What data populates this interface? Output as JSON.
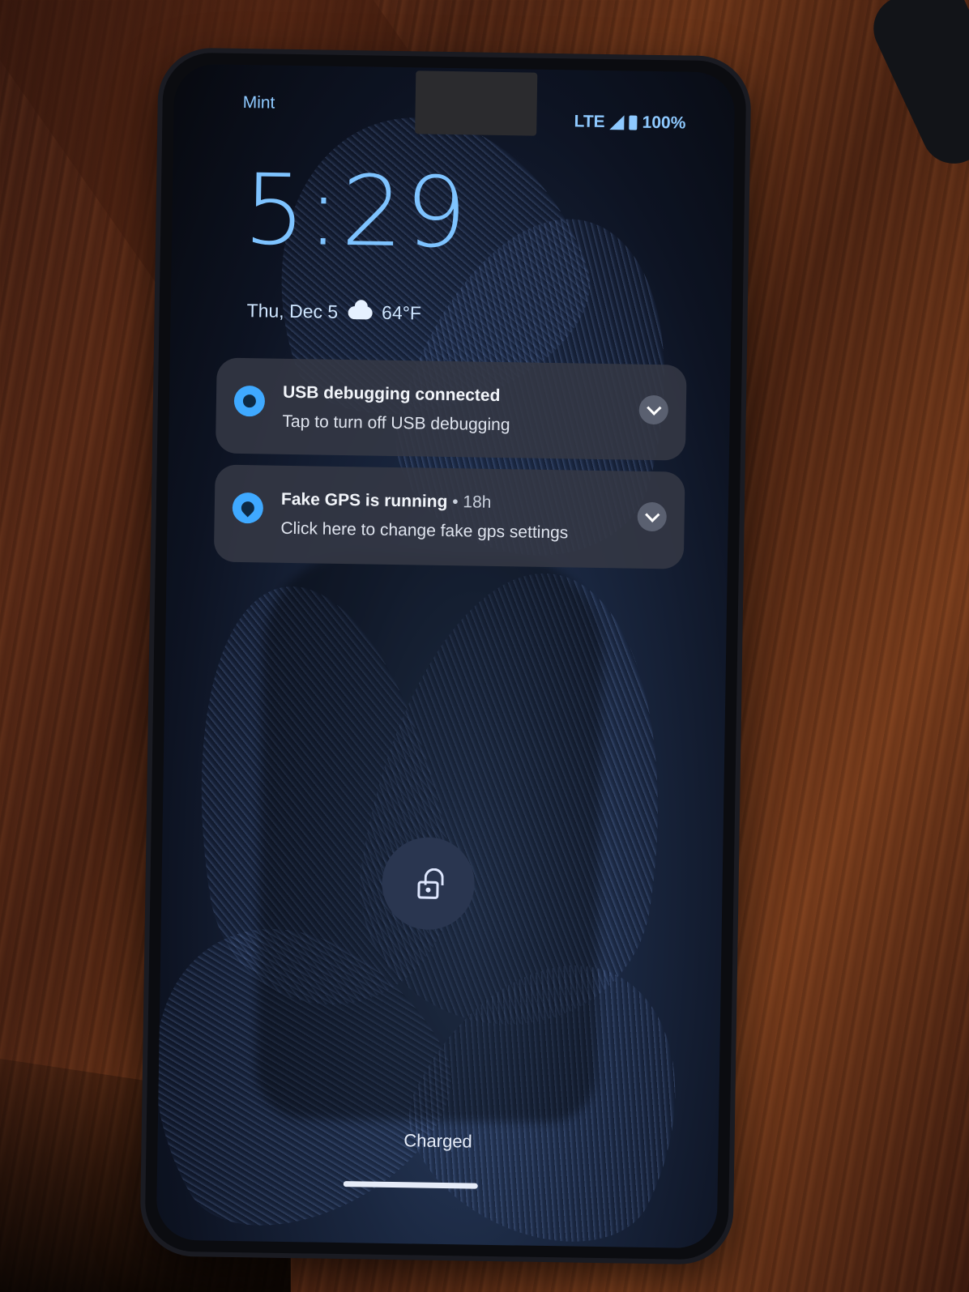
{
  "status_bar": {
    "carrier": "Mint",
    "network": "LTE",
    "battery": "100%"
  },
  "lockscreen": {
    "time": "5:29",
    "date": "Thu, Dec 5",
    "temperature": "64°F",
    "weather_icon": "cloud-icon"
  },
  "notifications": [
    {
      "title": "USB debugging connected",
      "meta": "",
      "body": "Tap to turn off USB debugging",
      "icon": "android-debug-icon"
    },
    {
      "title": "Fake GPS is running",
      "meta": " • 18h",
      "body": "Click here to change fake gps settings",
      "icon": "location-pin-icon"
    }
  ],
  "bottom": {
    "charge_status": "Charged",
    "unlock_icon": "unlock-icon"
  },
  "colors": {
    "clock": "#7ec3ff",
    "status": "#8ec9ff",
    "notification_bg": "#343844",
    "accent": "#3fa9ff"
  }
}
